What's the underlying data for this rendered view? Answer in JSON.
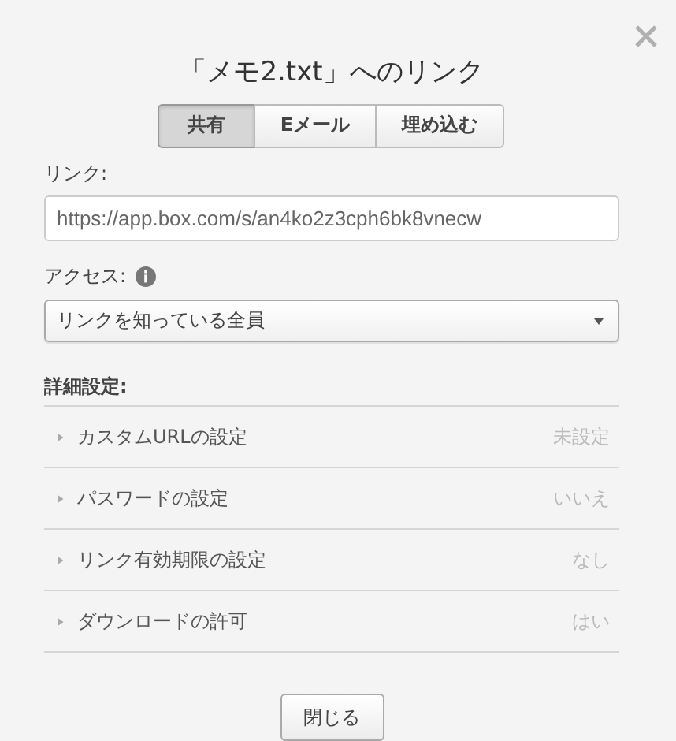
{
  "dialog": {
    "title": "「メモ2.txt」へのリンク"
  },
  "tabs": [
    {
      "label": "共有",
      "selected": true
    },
    {
      "label": "Eメール",
      "selected": false
    },
    {
      "label": "埋め込む",
      "selected": false
    }
  ],
  "link": {
    "label": "リンク:",
    "value": "https://app.box.com/s/an4ko2z3cph6bk8vnecw"
  },
  "access": {
    "label": "アクセス:",
    "value": "リンクを知っている全員"
  },
  "details": {
    "label": "詳細設定:",
    "rows": [
      {
        "name": "カスタムURLの設定",
        "value": "未設定",
        "expanded": false
      },
      {
        "name": "パスワードの設定",
        "value": "いいえ",
        "expanded": false
      },
      {
        "name": "リンク有効期限の設定",
        "value": "なし",
        "expanded": false
      },
      {
        "name": "ダウンロードの許可",
        "value": "はい",
        "expanded": false
      }
    ]
  },
  "buttons": [
    "閉じる"
  ]
}
